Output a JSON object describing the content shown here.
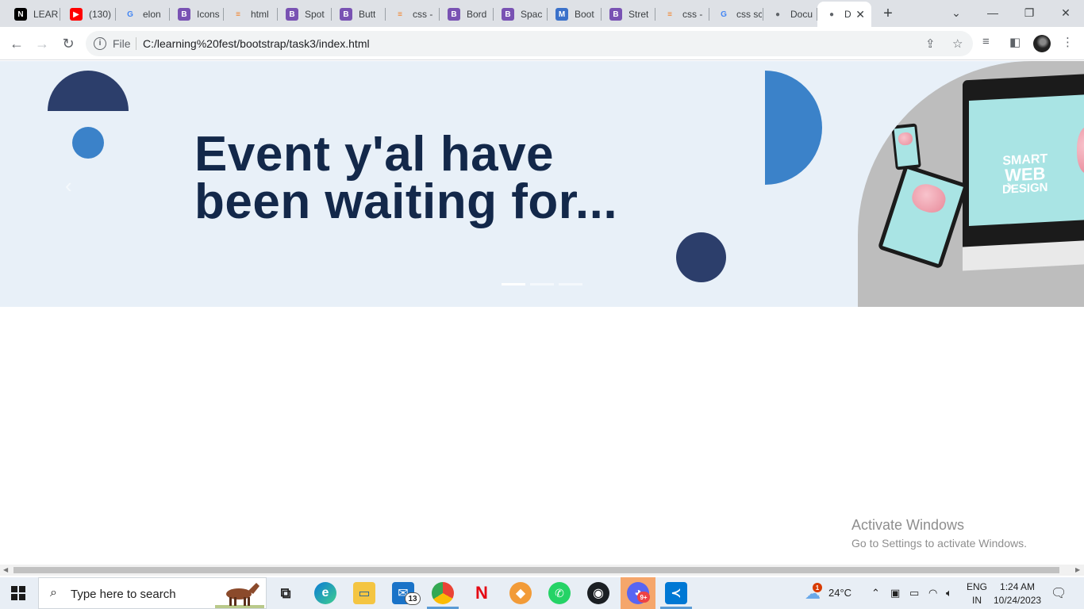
{
  "browser": {
    "tabs": [
      {
        "label": "LEAR",
        "icon": "notion-icon",
        "color": "#000000",
        "glyph": "N"
      },
      {
        "label": "(130)",
        "icon": "youtube-icon",
        "color": "#ff0000",
        "glyph": "▶"
      },
      {
        "label": "elon",
        "icon": "google-icon",
        "color": "#4285f4",
        "glyph": "G"
      },
      {
        "label": "Icons",
        "icon": "bootstrap-icon",
        "color": "#7952b3",
        "glyph": "B"
      },
      {
        "label": "html",
        "icon": "stackoverflow-icon",
        "color": "#f48024",
        "glyph": "≡"
      },
      {
        "label": "Spot",
        "icon": "bootstrap-icon",
        "color": "#7952b3",
        "glyph": "B"
      },
      {
        "label": "Butt",
        "icon": "bootstrap-icon",
        "color": "#7952b3",
        "glyph": "B"
      },
      {
        "label": "css -",
        "icon": "stackoverflow-icon",
        "color": "#f48024",
        "glyph": "≡"
      },
      {
        "label": "Bord",
        "icon": "bootstrap-icon",
        "color": "#7952b3",
        "glyph": "B"
      },
      {
        "label": "Spac",
        "icon": "bootstrap-icon",
        "color": "#7952b3",
        "glyph": "B"
      },
      {
        "label": "Boot",
        "icon": "mdb-icon",
        "color": "#3b71ca",
        "glyph": "M"
      },
      {
        "label": "Stret",
        "icon": "bootstrap-icon",
        "color": "#7952b3",
        "glyph": "B"
      },
      {
        "label": "css -",
        "icon": "stackoverflow-icon",
        "color": "#f48024",
        "glyph": "≡"
      },
      {
        "label": "css sc",
        "icon": "google-icon",
        "color": "#4285f4",
        "glyph": "G"
      },
      {
        "label": "Docu",
        "icon": "globe-icon",
        "color": "#5f6368",
        "glyph": "●"
      },
      {
        "label": "D",
        "icon": "globe-icon",
        "color": "#5f6368",
        "glyph": "●"
      }
    ],
    "address": {
      "scheme_label": "File",
      "url": "C:/learning%20fest/bootstrap/task3/index.html"
    }
  },
  "page": {
    "headline": "Event y'al have been waiting for...",
    "mockup": {
      "line1": "SMART",
      "line2": "WEB",
      "line3": "DESIGN"
    },
    "indicators": [
      true,
      false,
      false
    ]
  },
  "watermark": {
    "title": "Activate Windows",
    "subtitle": "Go to Settings to activate Windows."
  },
  "taskbar": {
    "search_placeholder": "Type here to search",
    "mail_badge": "13",
    "discord_badge": "9+",
    "weather": "24°C",
    "weather_badge": "1",
    "lang_line1": "ENG",
    "lang_line2": "IN",
    "time": "1:24 AM",
    "date": "10/24/2023"
  },
  "colors": {
    "navy": "#2c3e6b",
    "blue": "#3b82c9",
    "hero_bg": "#e8f0f8",
    "headline": "#13284a"
  }
}
